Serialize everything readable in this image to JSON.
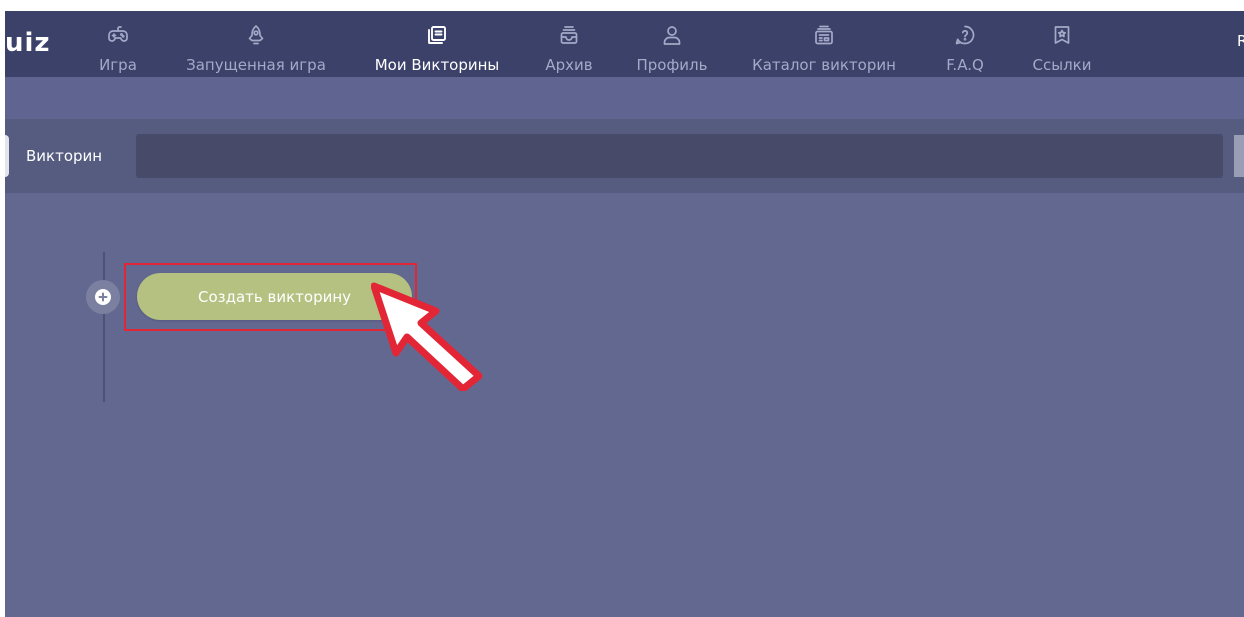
{
  "nav": {
    "logo": "uiz",
    "items": [
      {
        "label": "Игра",
        "icon": "gamepad-icon"
      },
      {
        "label": "Запущенная игра",
        "icon": "rocket-icon"
      },
      {
        "label": "Мои Викторины",
        "icon": "quiz-list-icon",
        "active": true
      },
      {
        "label": "Архив",
        "icon": "archive-icon"
      },
      {
        "label": "Профиль",
        "icon": "profile-icon"
      },
      {
        "label": "Каталог викторин",
        "icon": "catalog-icon"
      },
      {
        "label": "F.A.Q",
        "icon": "help-icon"
      },
      {
        "label": "Ссылки",
        "icon": "bookmark-icon"
      }
    ],
    "user_initial": "R"
  },
  "filter": {
    "label": "Викторин",
    "search_value": ""
  },
  "content": {
    "create_button_label": "Создать викторину"
  },
  "colors": {
    "nav_bg": "#3c4169",
    "content_bg": "#636891",
    "filter_bg": "#565b80",
    "button": "#b4c180",
    "highlight": "#e32636"
  }
}
